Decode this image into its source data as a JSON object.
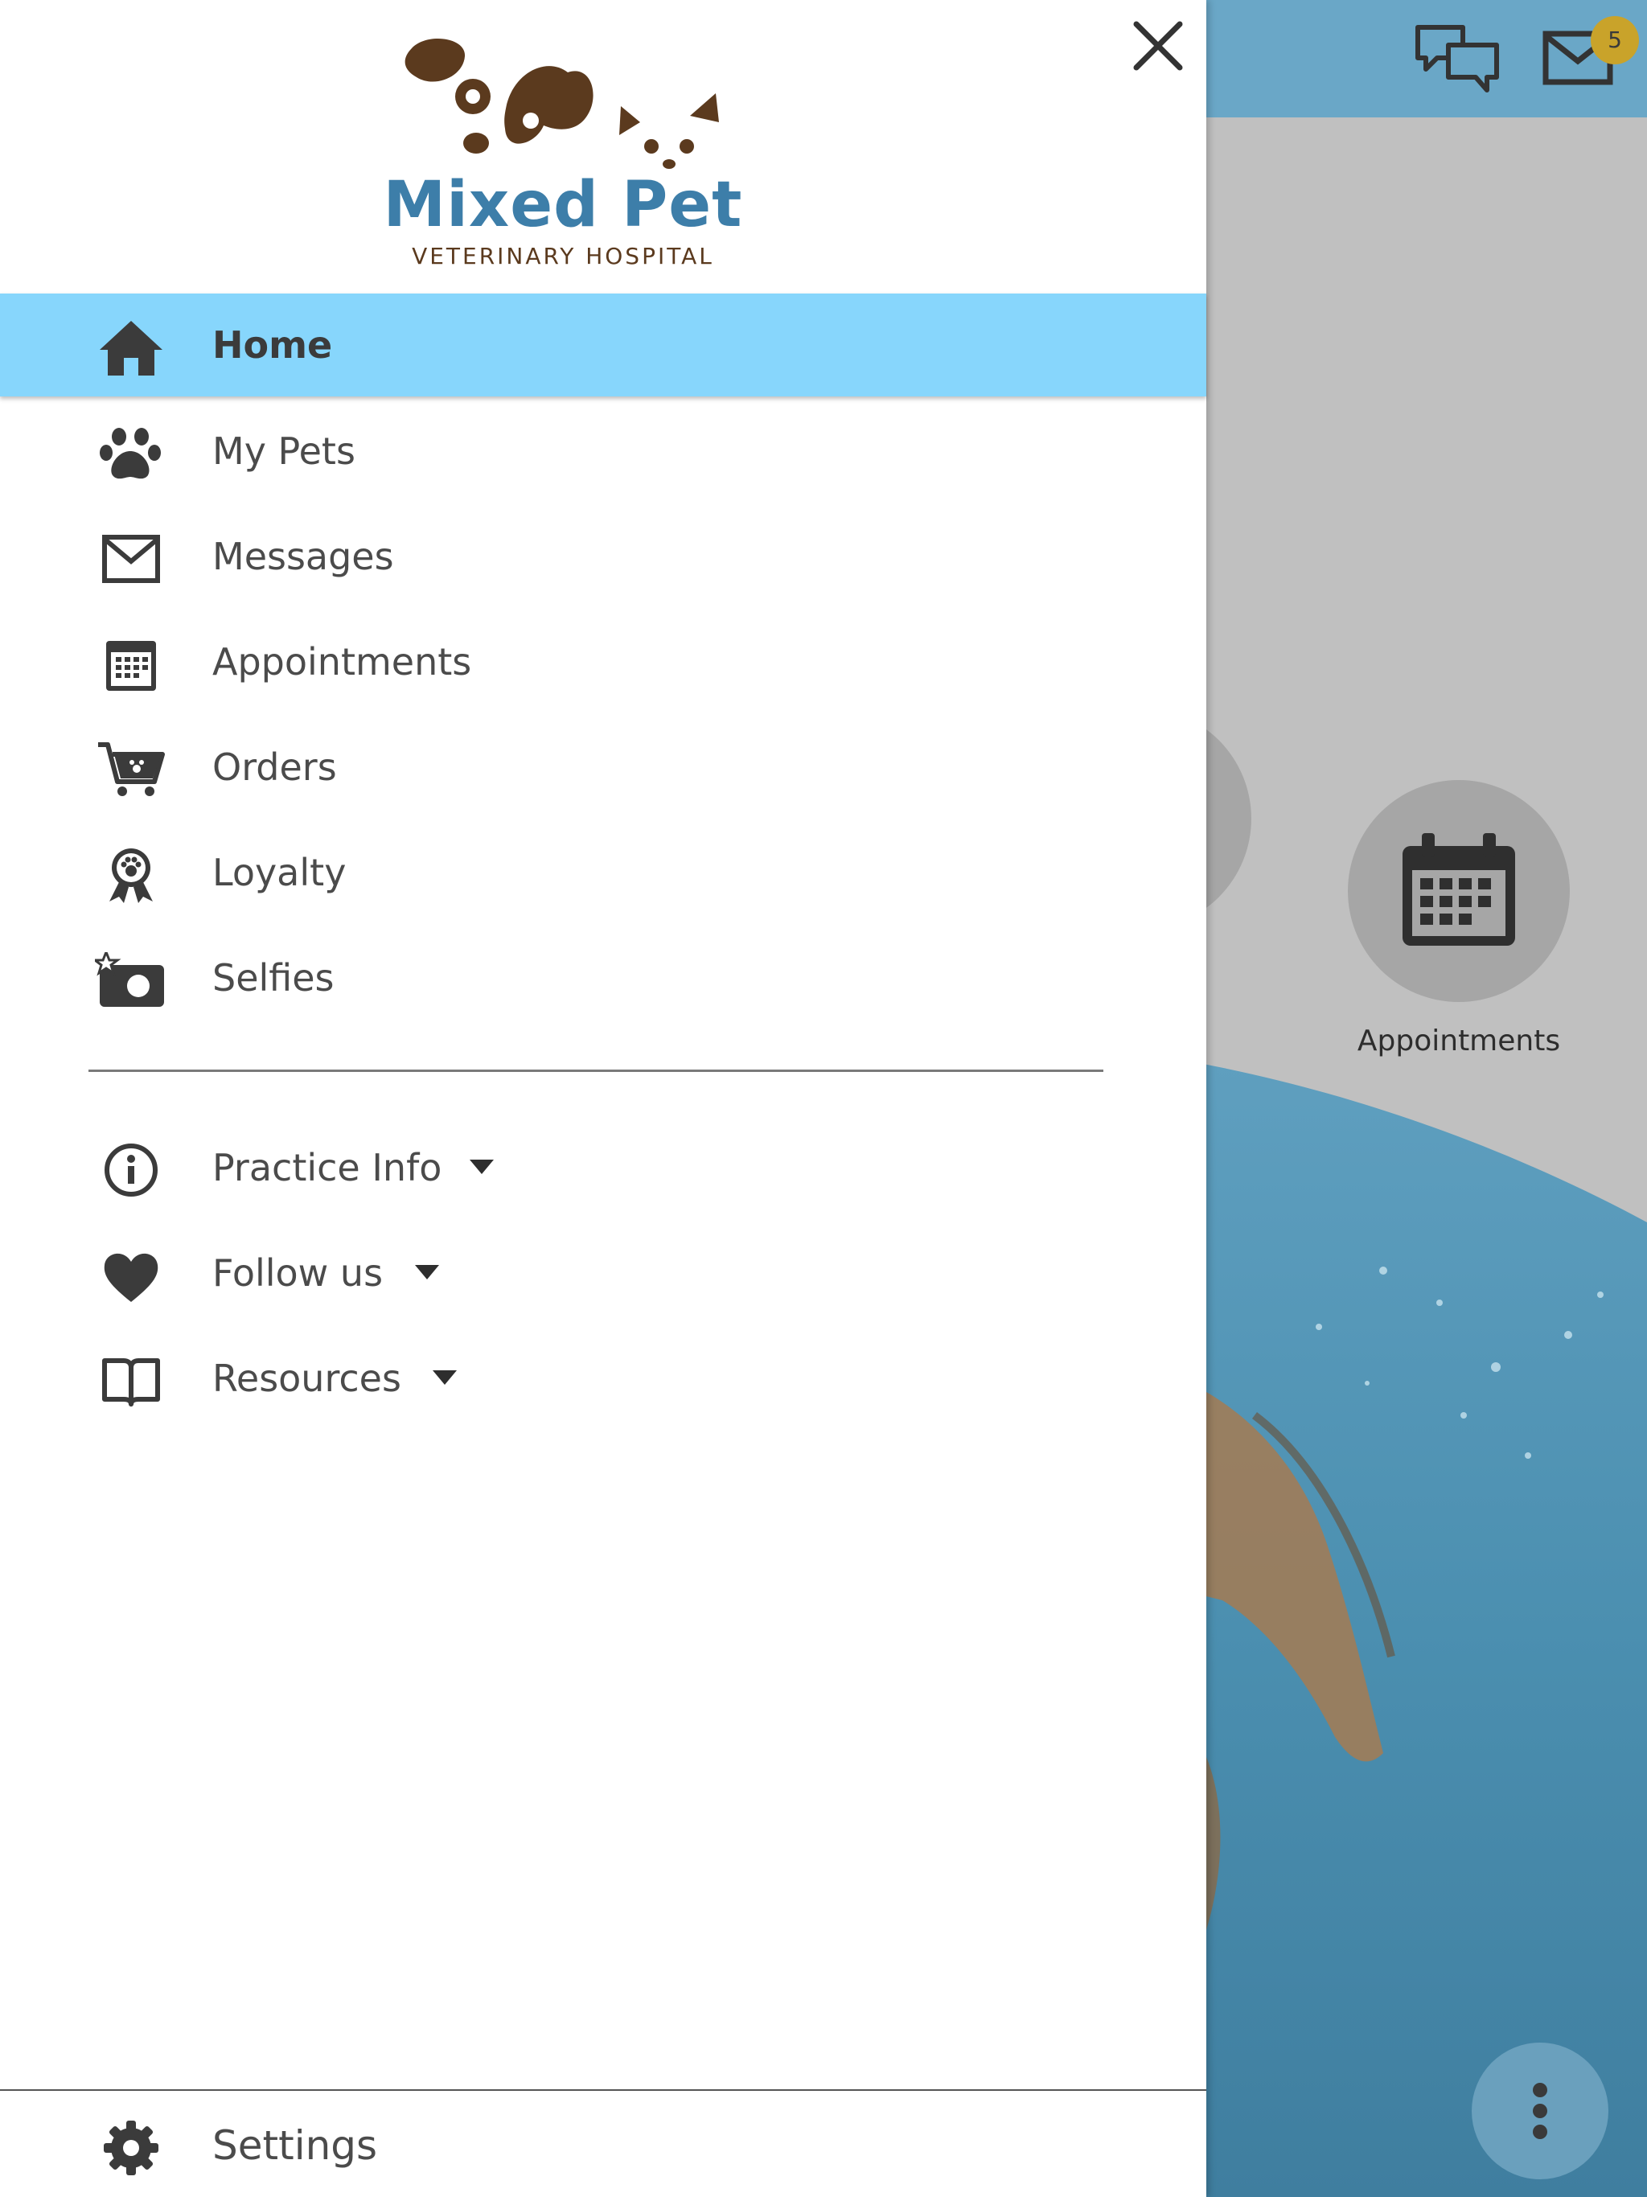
{
  "header": {
    "mail_badge_count": "5",
    "accent_color": "#6aa7c7",
    "badge_color": "#c9a32a"
  },
  "background": {
    "appointments_tile_label": "Appointments"
  },
  "drawer": {
    "logo": {
      "title": "Mixed Pet",
      "subtitle": "VETERINARY HOSPITAL"
    },
    "items": [
      {
        "label": "Home",
        "icon": "home-icon",
        "active": true
      },
      {
        "label": "My Pets",
        "icon": "paw-icon"
      },
      {
        "label": "Messages",
        "icon": "envelope-icon"
      },
      {
        "label": "Appointments",
        "icon": "calendar-icon"
      },
      {
        "label": "Orders",
        "icon": "cart-icon"
      },
      {
        "label": "Loyalty",
        "icon": "ribbon-paw-icon"
      },
      {
        "label": "Selfies",
        "icon": "camera-star-icon"
      }
    ],
    "secondary_items": [
      {
        "label": "Practice Info",
        "icon": "info-icon",
        "expandable": true
      },
      {
        "label": "Follow us",
        "icon": "heart-icon",
        "expandable": true
      },
      {
        "label": "Resources",
        "icon": "book-icon",
        "expandable": true
      }
    ],
    "settings": {
      "label": "Settings",
      "icon": "gear-icon"
    },
    "active_color": "#87d6fc"
  }
}
